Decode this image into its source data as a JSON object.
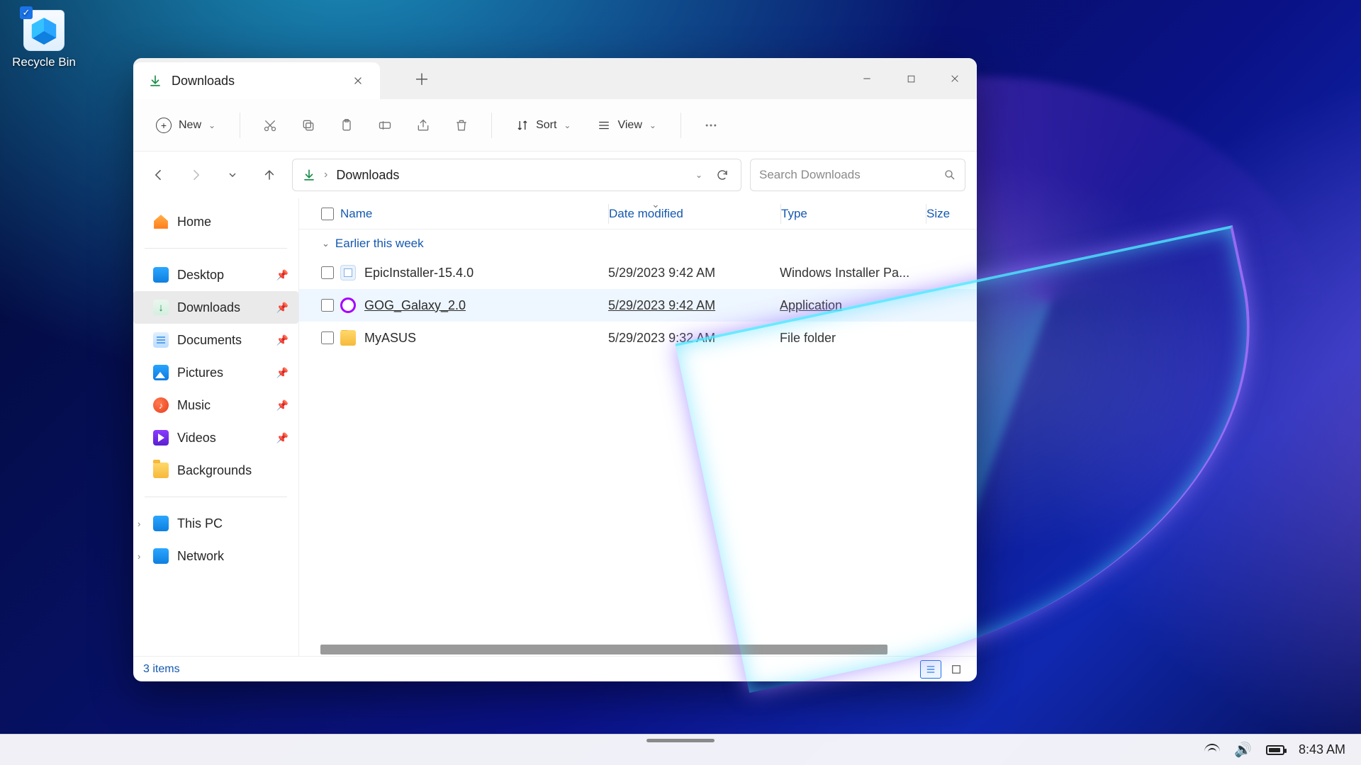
{
  "desktop": {
    "recycle_bin": "Recycle Bin"
  },
  "window": {
    "tab_title": "Downloads",
    "toolbar": {
      "new": "New",
      "sort": "Sort",
      "view": "View"
    },
    "breadcrumb": {
      "location": "Downloads"
    },
    "search": {
      "placeholder": "Search Downloads"
    }
  },
  "sidebar": {
    "home": "Home",
    "items": [
      {
        "label": "Desktop",
        "pinned": true
      },
      {
        "label": "Downloads",
        "pinned": true,
        "active": true
      },
      {
        "label": "Documents",
        "pinned": true
      },
      {
        "label": "Pictures",
        "pinned": true
      },
      {
        "label": "Music",
        "pinned": true
      },
      {
        "label": "Videos",
        "pinned": true
      },
      {
        "label": "Backgrounds",
        "pinned": false
      }
    ],
    "this_pc": "This PC",
    "network": "Network"
  },
  "columns": {
    "name": "Name",
    "date": "Date modified",
    "type": "Type",
    "size": "Size"
  },
  "group_header": "Earlier this week",
  "files": [
    {
      "name": "EpicInstaller-15.4.0",
      "date": "5/29/2023 9:42 AM",
      "type": "Windows Installer Pa...",
      "icon": "installer"
    },
    {
      "name": "GOG_Galaxy_2.0",
      "date": "5/29/2023 9:42 AM",
      "type": "Application",
      "icon": "gog",
      "hovered": true
    },
    {
      "name": "MyASUS",
      "date": "5/29/2023 9:32 AM",
      "type": "File folder",
      "icon": "folder"
    }
  ],
  "status": {
    "items": "3 items"
  },
  "taskbar": {
    "time": "8:43 AM"
  }
}
